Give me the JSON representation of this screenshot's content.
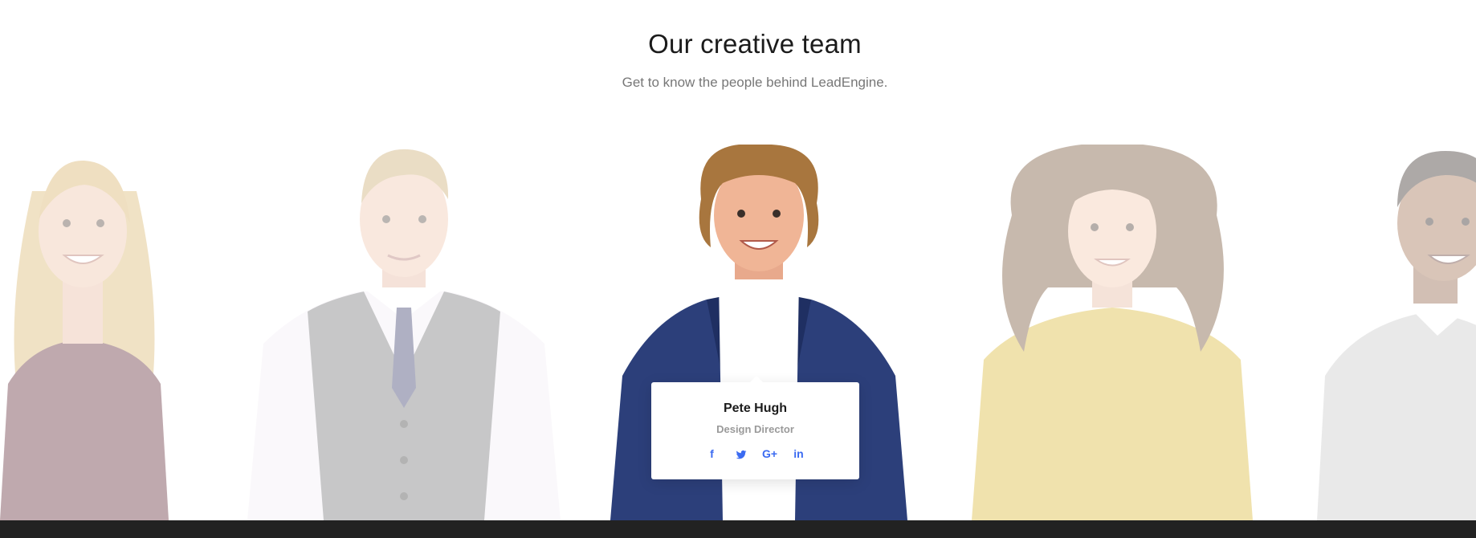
{
  "section": {
    "title": "Our creative team",
    "subtitle": "Get to know the people behind LeadEngine."
  },
  "featured_member": {
    "name": "Pete Hugh",
    "role": "Design Director",
    "social": [
      {
        "network": "facebook",
        "icon": "facebook-icon",
        "glyph": "f"
      },
      {
        "network": "twitter",
        "icon": "twitter-icon",
        "glyph": ""
      },
      {
        "network": "google-plus",
        "icon": "google-plus-icon",
        "glyph": "G+"
      },
      {
        "network": "linkedin",
        "icon": "linkedin-icon",
        "glyph": "in"
      }
    ]
  },
  "colors": {
    "accent": "#3b6bf1",
    "footer": "#222222",
    "title": "#1b1b1b",
    "subtitle": "#777777"
  }
}
